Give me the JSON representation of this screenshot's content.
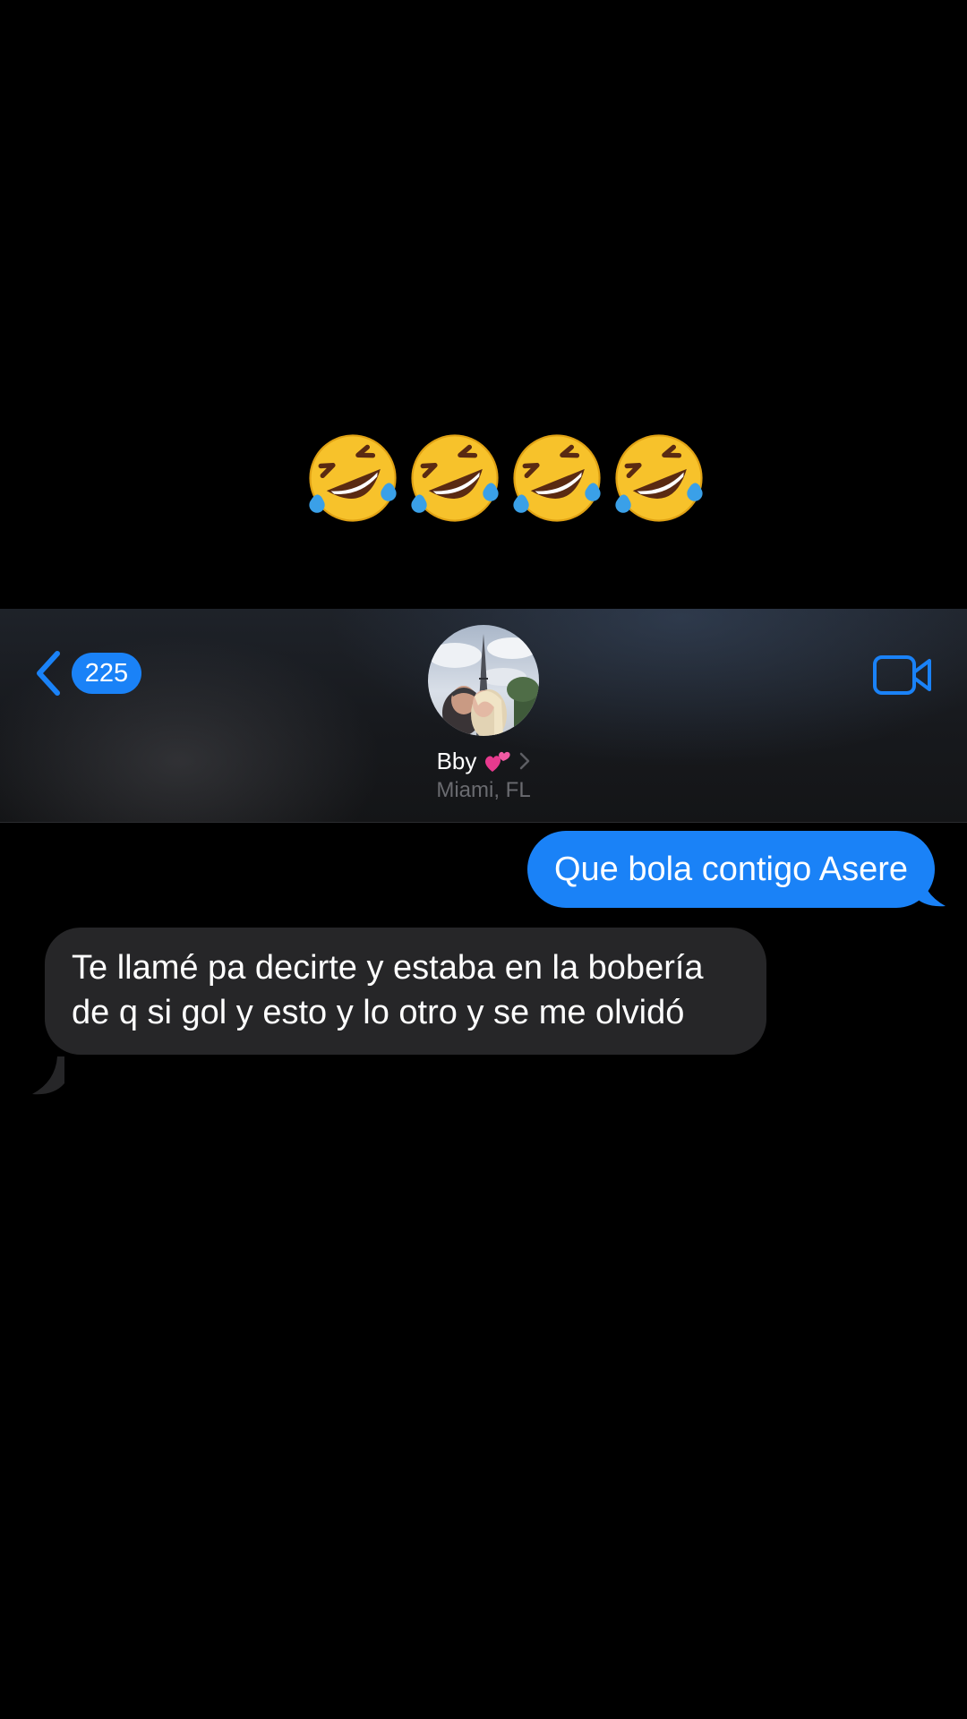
{
  "caption": {
    "emojis": [
      "rolling-on-floor-laughing",
      "rolling-on-floor-laughing",
      "rolling-on-floor-laughing",
      "rolling-on-floor-laughing"
    ]
  },
  "header": {
    "back_badge_count": "225",
    "contact_name": "Bby",
    "contact_name_emoji": "two-hearts",
    "contact_location": "Miami, FL",
    "avatar": "contact-photo",
    "video_icon": "video-camera-icon"
  },
  "messages": [
    {
      "direction": "sent",
      "text": "Que bola contigo Asere"
    },
    {
      "direction": "received",
      "text": "Te llamé pa decirte y estaba en la bobería de q si gol y esto y lo otro y se me olvidó"
    }
  ],
  "colors": {
    "accent": "#1a82f7",
    "sent_bubble": "#1a82f7",
    "received_bubble": "#262628",
    "background": "#000000",
    "secondary_text": "#6a6b70"
  }
}
